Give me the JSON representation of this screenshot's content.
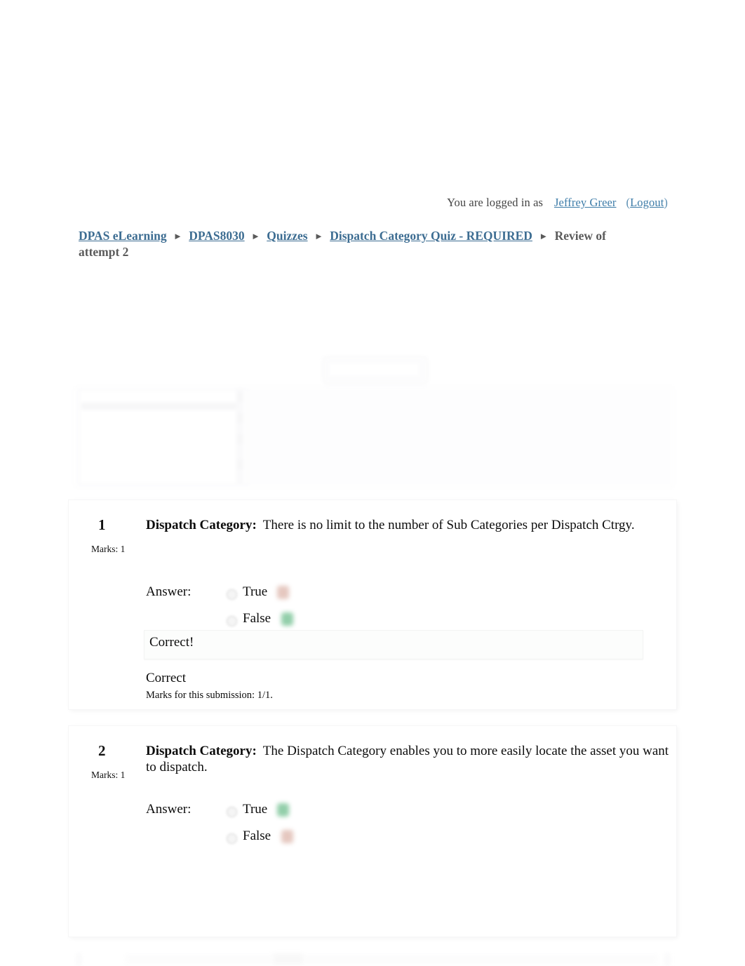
{
  "session": {
    "logged_in_prefix": "You are logged in as",
    "user_name": "Jeffrey Greer",
    "paren_open": "(",
    "logout_label": "Logout",
    "paren_close": ")"
  },
  "breadcrumb": {
    "separator": "►",
    "items": [
      {
        "label": "DPAS eLearning",
        "current": false
      },
      {
        "label": "DPAS8030",
        "current": false
      },
      {
        "label": "Quizzes",
        "current": false
      },
      {
        "label": "Dispatch Category Quiz - REQUIRED",
        "current": false
      },
      {
        "label": "Review of attempt 2",
        "current": true
      }
    ]
  },
  "colors": {
    "link_blue": "#3d7ca8",
    "breadcrumb_link": "#3d6d92",
    "breadcrumb_current": "#5a5a5a",
    "correct_green": "#3aa765",
    "incorrect_red": "#d09b8c",
    "page_background": "#ffffff"
  },
  "questions": [
    {
      "number": "1",
      "marks": "Marks: 1",
      "label": "Dispatch Category:",
      "text": "There is no limit to the number of Sub Categories per Dispatch Ctrgy.",
      "answer_label": "Answer:",
      "options": [
        {
          "text": "True",
          "mark": "incorrect"
        },
        {
          "text": "False",
          "mark": "correct"
        }
      ],
      "feedback": "Correct!",
      "grade": "Correct",
      "submission": "Marks for this submission: 1/1."
    },
    {
      "number": "2",
      "marks": "Marks: 1",
      "label": "Dispatch Category:",
      "text": "The Dispatch Category enables you to more easily locate the asset you want to dispatch.",
      "answer_label": "Answer:",
      "options": [
        {
          "text": "True",
          "mark": "correct"
        },
        {
          "text": "False",
          "mark": "incorrect"
        }
      ],
      "feedback": "",
      "grade": "",
      "submission": ""
    }
  ]
}
